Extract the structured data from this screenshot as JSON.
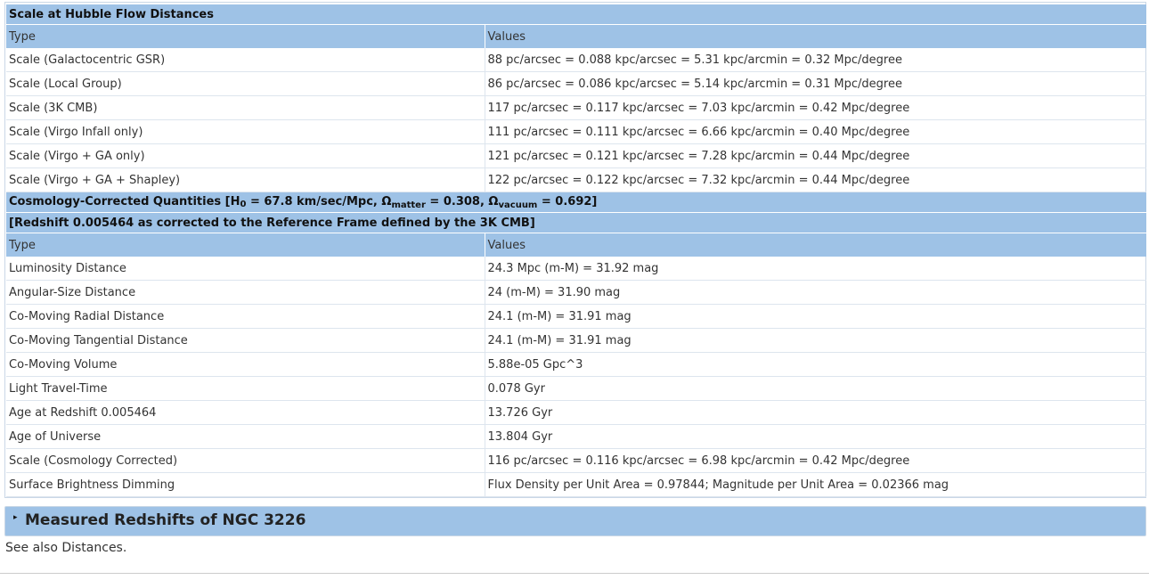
{
  "hubble": {
    "title": "Scale at Hubble Flow Distances",
    "col_type": "Type",
    "col_values": "Values",
    "rows": [
      {
        "type": "Scale (Galactocentric GSR)",
        "value": "88 pc/arcsec = 0.088 kpc/arcsec = 5.31 kpc/arcmin = 0.32 Mpc/degree"
      },
      {
        "type": "Scale (Local Group)",
        "value": "86 pc/arcsec = 0.086 kpc/arcsec = 5.14 kpc/arcmin = 0.31 Mpc/degree"
      },
      {
        "type": "Scale (3K CMB)",
        "value": "117 pc/arcsec = 0.117 kpc/arcsec = 7.03 kpc/arcmin = 0.42 Mpc/degree"
      },
      {
        "type": "Scale (Virgo Infall only)",
        "value": "111 pc/arcsec = 0.111 kpc/arcsec = 6.66 kpc/arcmin = 0.40 Mpc/degree"
      },
      {
        "type": "Scale (Virgo + GA only)",
        "value": "121 pc/arcsec = 0.121 kpc/arcsec = 7.28 kpc/arcmin = 0.44 Mpc/degree"
      },
      {
        "type": "Scale (Virgo + GA + Shapley)",
        "value": "122 pc/arcsec = 0.122 kpc/arcsec = 7.32 kpc/arcmin = 0.44 Mpc/degree"
      }
    ]
  },
  "cosmology": {
    "title_prefix": "Cosmology-Corrected Quantities [H",
    "h0_sub": "0",
    "h0_value": " = 67.8 km/sec/Mpc, Ω",
    "matter_sub": "matter",
    "matter_value": " = 0.308, Ω",
    "vacuum_sub": "vacuum",
    "vacuum_value": " = 0.692]",
    "subtitle": "[Redshift 0.005464 as corrected to the Reference Frame defined by the 3K CMB]",
    "col_type": "Type",
    "col_values": "Values",
    "rows": [
      {
        "type": "Luminosity Distance",
        "value": "24.3 Mpc (m-M) = 31.92 mag"
      },
      {
        "type": "Angular-Size Distance",
        "value": "24 (m-M) = 31.90 mag"
      },
      {
        "type": "Co-Moving Radial Distance",
        "value": "24.1 (m-M) = 31.91 mag"
      },
      {
        "type": "Co-Moving Tangential Distance",
        "value": "24.1 (m-M) = 31.91 mag"
      },
      {
        "type": "Co-Moving Volume",
        "value": "5.88e-05 Gpc^3"
      },
      {
        "type": "Light Travel-Time",
        "value": "0.078 Gyr"
      },
      {
        "type": "Age at Redshift 0.005464",
        "value": "13.726 Gyr"
      },
      {
        "type": "Age of Universe",
        "value": "13.804 Gyr"
      },
      {
        "type": "Scale (Cosmology Corrected)",
        "value": "116 pc/arcsec = 0.116 kpc/arcsec = 6.98 kpc/arcmin = 0.42 Mpc/degree"
      },
      {
        "type": "Surface Brightness Dimming",
        "value": "Flux Density per Unit Area = 0.97844; Magnitude per Unit Area = 0.02366 mag"
      }
    ]
  },
  "redshifts_section": {
    "arrow": "▸",
    "title": "Measured Redshifts of NGC 3226"
  },
  "see_also": "See also Distances.",
  "colors": {
    "header_bg": "#9ec2e6",
    "border": "#c9d7e6"
  }
}
